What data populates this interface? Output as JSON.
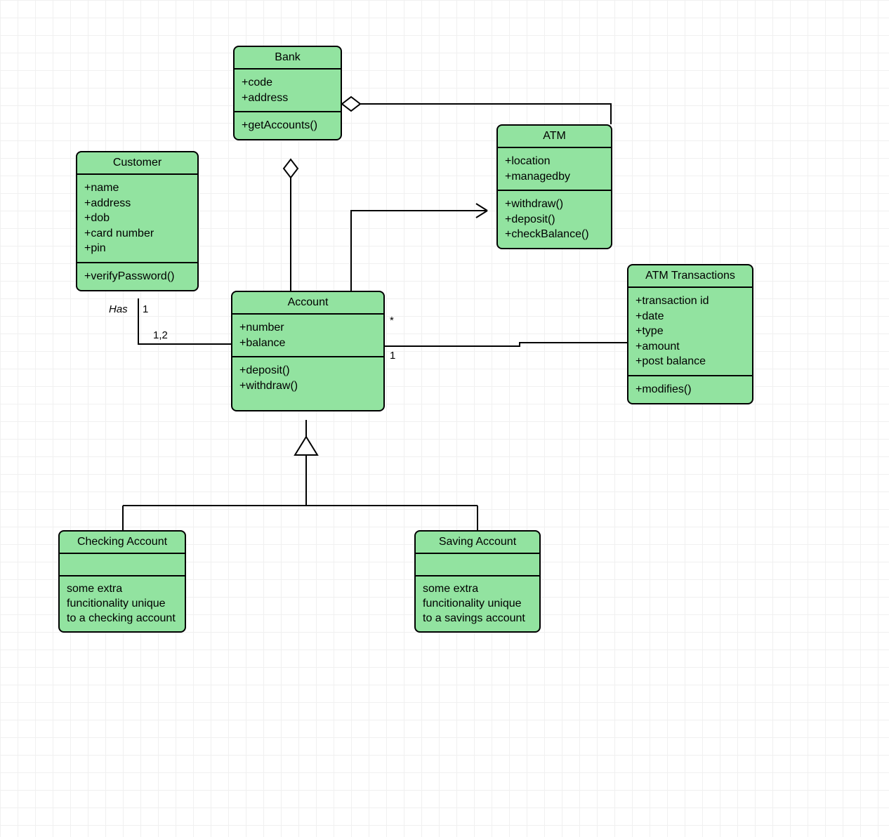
{
  "colors": {
    "classFill": "#92e3a0",
    "border": "#000000"
  },
  "classes": {
    "bank": {
      "name": "Bank",
      "attrs": [
        "+code",
        "+address"
      ],
      "ops": [
        "+getAccounts()"
      ]
    },
    "customer": {
      "name": "Customer",
      "attrs": [
        "+name",
        "+address",
        "+dob",
        "+card number",
        "+pin"
      ],
      "ops": [
        "+verifyPassword()"
      ]
    },
    "atm": {
      "name": "ATM",
      "attrs": [
        "+location",
        "+managedby"
      ],
      "ops": [
        "+withdraw()",
        "+deposit()",
        "+checkBalance()"
      ]
    },
    "account": {
      "name": "Account",
      "attrs": [
        "+number",
        "+balance"
      ],
      "ops": [
        "+deposit()",
        "+withdraw()"
      ]
    },
    "atmTxn": {
      "name": "ATM Transactions",
      "attrs": [
        "+transaction id",
        "+date",
        "+type",
        "+amount",
        "+post balance"
      ],
      "ops": [
        "+modifies()"
      ]
    },
    "checking": {
      "name": "Checking Account",
      "attrs": [],
      "ops": [
        "some extra funcitionality unique to a checking account"
      ]
    },
    "saving": {
      "name": "Saving Account",
      "attrs": [],
      "ops": [
        "some extra funcitionality unique to a savings account"
      ]
    }
  },
  "labels": {
    "has": "Has",
    "one_a": "1",
    "one_b": "1,2",
    "star": "*",
    "one_c": "1"
  },
  "relations": [
    {
      "from": "Bank",
      "to": "ATM",
      "type": "aggregation",
      "diamondAt": "Bank"
    },
    {
      "from": "Bank",
      "to": "Account",
      "type": "aggregation",
      "diamondAt": "Bank"
    },
    {
      "from": "Customer",
      "to": "Account",
      "type": "association",
      "label": "Has",
      "multiplicity": {
        "customer": "1",
        "account": "1,2"
      }
    },
    {
      "from": "Account",
      "to": "ATM",
      "type": "navigable-association",
      "multiplicity": {
        "account": "*"
      }
    },
    {
      "from": "Account",
      "to": "ATM Transactions",
      "type": "association",
      "multiplicity": {
        "account": "1"
      }
    },
    {
      "from": "Checking Account",
      "to": "Account",
      "type": "generalization"
    },
    {
      "from": "Saving Account",
      "to": "Account",
      "type": "generalization"
    }
  ]
}
